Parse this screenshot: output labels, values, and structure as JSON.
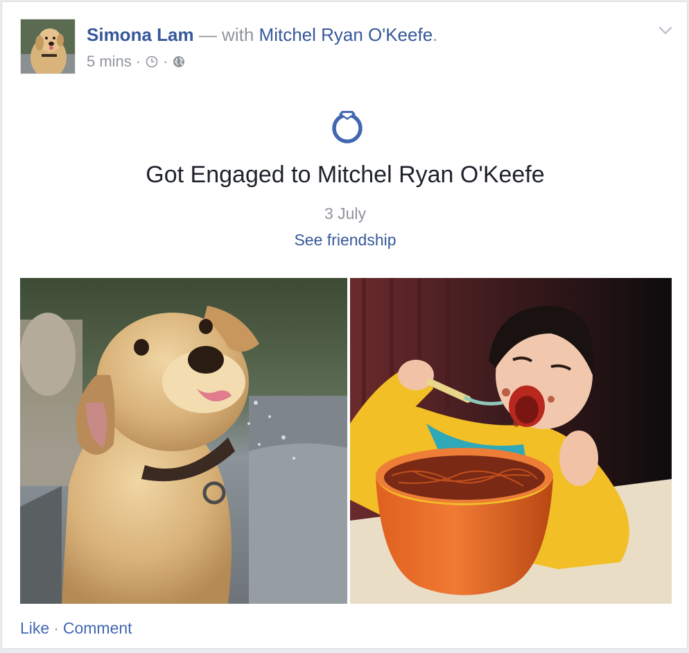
{
  "post": {
    "author_name": "Simona Lam",
    "with_text": "— with",
    "tagged_name": "Mitchel Ryan O'Keefe",
    "tagged_suffix": ".",
    "timestamp": "5 mins",
    "meta_separator": "·",
    "icons": {
      "avatar": "dog-avatar",
      "clock": "clock-icon",
      "audience": "globe-icon",
      "menu": "chevron-down-icon",
      "event": "engagement-ring-icon"
    }
  },
  "life_event": {
    "title": "Got Engaged to Mitchel Ryan O'Keefe",
    "date": "3 July",
    "friendship_link": "See friendship"
  },
  "photos": [
    {
      "subject": "dog-photo"
    },
    {
      "subject": "child-eating-spaghetti-photo"
    }
  ],
  "actions": {
    "like": "Like",
    "separator": "·",
    "comment": "Comment"
  },
  "colors": {
    "link": "#365899",
    "action_link": "#4267b2",
    "muted": "#90949c",
    "ring": "#4267b2",
    "text": "#1d2129"
  }
}
